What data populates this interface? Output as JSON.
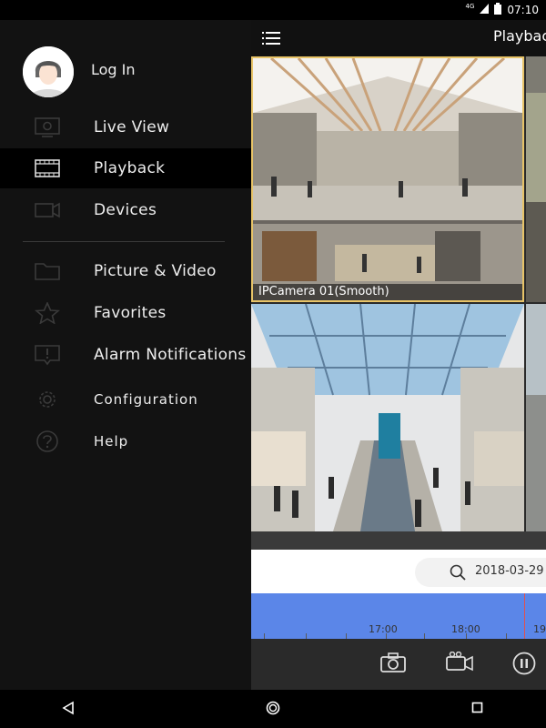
{
  "status": {
    "network": "4G",
    "time": "07:10"
  },
  "header": {
    "title": "Playback"
  },
  "drawer": {
    "login_label": "Log In",
    "items": [
      {
        "label": "Live View",
        "icon": "live-view-icon"
      },
      {
        "label": "Playback",
        "icon": "film-icon",
        "active": true
      },
      {
        "label": "Devices",
        "icon": "camera-icon"
      },
      {
        "label": "Picture & Video",
        "icon": "folder-icon"
      },
      {
        "label": "Favorites",
        "icon": "star-icon"
      },
      {
        "label": "Alarm Notifications",
        "icon": "alarm-icon"
      },
      {
        "label": "Configuration",
        "icon": "gear-icon"
      },
      {
        "label": "Help",
        "icon": "help-icon"
      }
    ]
  },
  "cameras": [
    {
      "label": "IPCamera 01(Smooth)",
      "selected": true
    }
  ],
  "date": {
    "value": "2018-03-29"
  },
  "timeline": {
    "labels": [
      "17:00",
      "18:00",
      "19"
    ]
  },
  "colors": {
    "accent": "#e8c468",
    "timeline": "#5b86e8",
    "cursor": "#e05050"
  }
}
